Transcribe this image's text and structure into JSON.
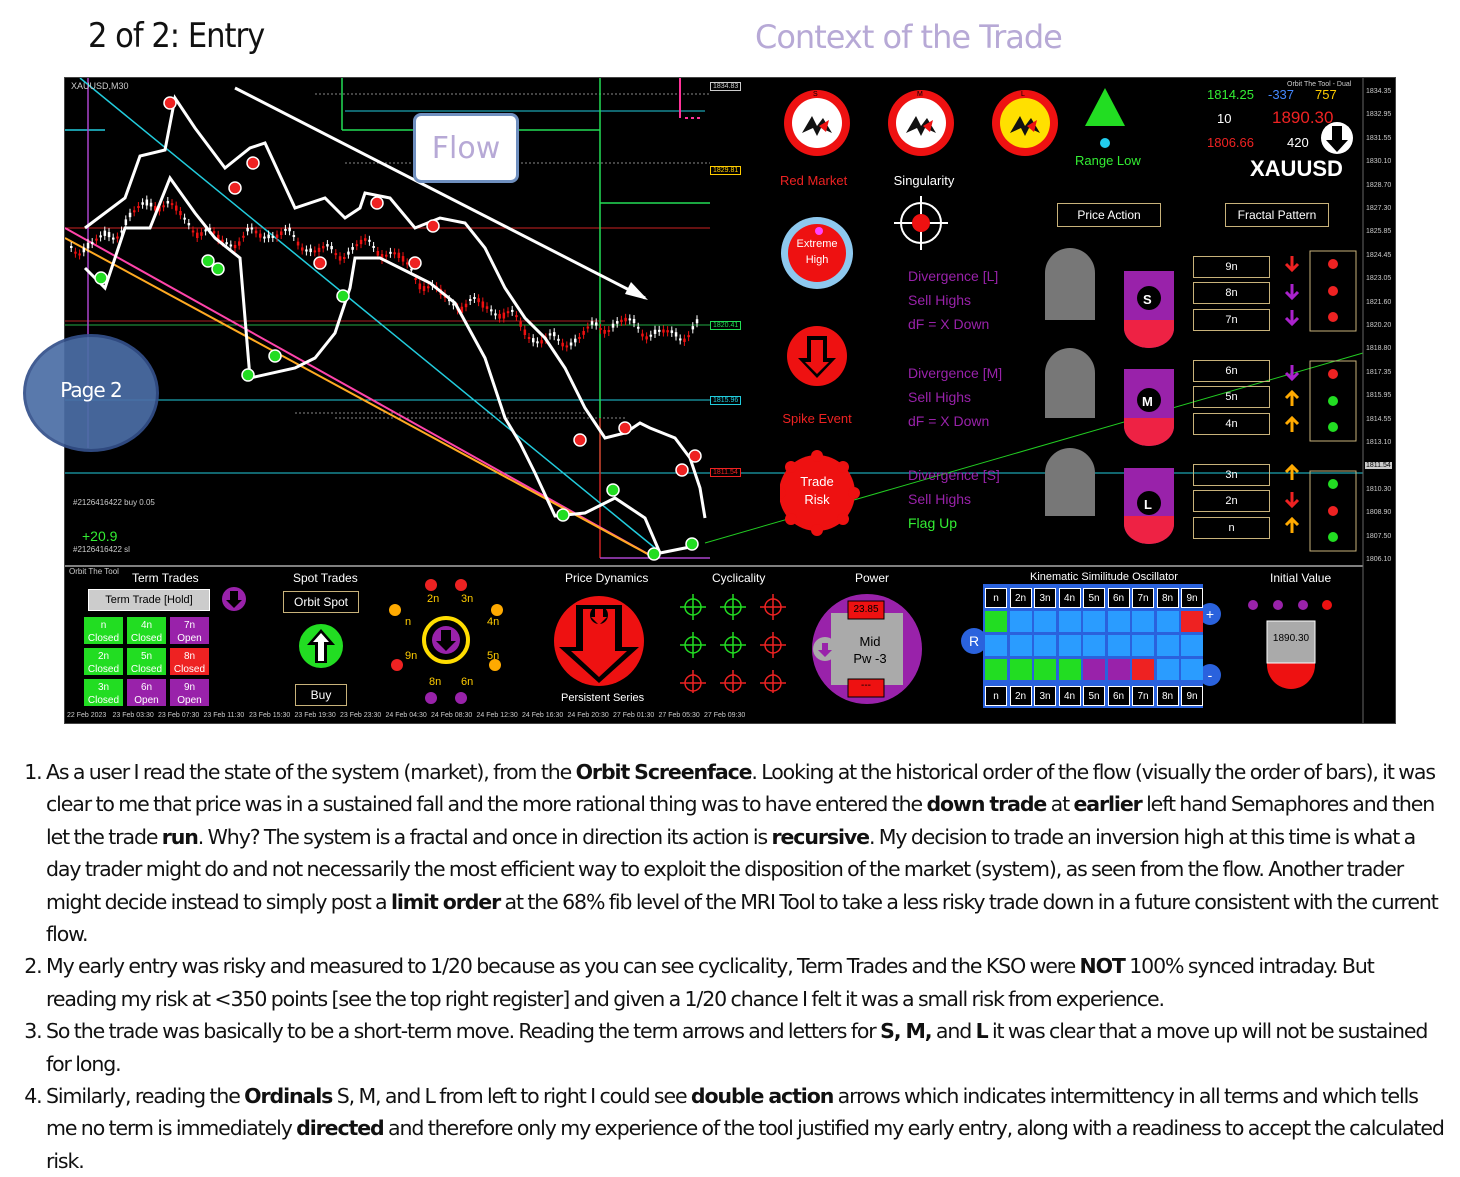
{
  "header": {
    "title_left": "2 of 2: Entry",
    "title_right": "Context of the Trade"
  },
  "chart": {
    "symbol": "XAUUSD,M30",
    "flow_label": "Flow",
    "page_label": "Page 2",
    "order_buy": "#2126416422 buy 0.05",
    "order_sl": "#2126416422 sl",
    "profit": "+20.9",
    "price_tags": [
      "1834.83",
      "1829.81",
      "1820.41",
      "1815.96",
      "1811.54"
    ],
    "right_axis": [
      "1834.35",
      "1832.95",
      "1831.55",
      "1830.10",
      "1828.70",
      "1827.30",
      "1825.85",
      "1824.45",
      "1823.05",
      "1821.60",
      "1820.20",
      "1818.80",
      "1817.35",
      "1815.95",
      "1814.55",
      "1813.10",
      "1811.54",
      "1810.30",
      "1808.90",
      "1807.50",
      "1806.10"
    ],
    "time_axis": [
      "22 Feb 2023",
      "23 Feb 03:30",
      "23 Feb 07:30",
      "23 Feb 11:30",
      "23 Feb 15:30",
      "23 Feb 19:30",
      "23 Feb 23:30",
      "24 Feb 04:30",
      "24 Feb 08:30",
      "24 Feb 12:30",
      "24 Feb 16:30",
      "24 Feb 20:30",
      "27 Feb 01:30",
      "27 Feb 05:30",
      "27 Feb 09:30"
    ]
  },
  "context": {
    "sem_s": "S",
    "sem_m": "M",
    "sem_l": "L",
    "red_market": "Red Market",
    "singularity": "Singularity",
    "range_low": "Range Low",
    "extreme_high": "Extreme High",
    "spike_event": "Spike Event",
    "trade_risk": "Trade Risk",
    "div_l": [
      "Divergence [L]",
      "Sell Highs",
      "dF = X Down"
    ],
    "div_m": [
      "Divergence [M]",
      "Sell Highs",
      "dF = X Down"
    ],
    "div_s": [
      "Divergence [S]",
      "Sell Highs",
      "Flag Up"
    ],
    "price_action": "Price Action",
    "fractal_pattern": "Fractal Pattern",
    "term_s": "S",
    "term_m": "M",
    "term_l": "L",
    "ordinals": [
      "9n",
      "8n",
      "7n",
      "6n",
      "5n",
      "4n",
      "3n",
      "2n",
      "n"
    ],
    "register": {
      "v1": "1814.25",
      "v2": "-337",
      "v3": "757",
      "v4": "10",
      "v5": "1890.30",
      "v6": "1806.66",
      "v7": "420",
      "symbol": "XAUUSD",
      "tool": "Orbit The Tool - Dual"
    }
  },
  "bottom": {
    "tool_name": "Orbit The Tool",
    "term_trades": "Term Trades",
    "term_trade_hold": "Term Trade [Hold]",
    "term_cells": [
      {
        "t": "n",
        "s": "Closed",
        "c": "#22dd22"
      },
      {
        "t": "4n",
        "s": "Closed",
        "c": "#22dd22"
      },
      {
        "t": "7n",
        "s": "Open",
        "c": "#9922aa"
      },
      {
        "t": "2n",
        "s": "Closed",
        "c": "#22dd22"
      },
      {
        "t": "5n",
        "s": "Closed",
        "c": "#22dd22"
      },
      {
        "t": "8n",
        "s": "Closed",
        "c": "#ee2222"
      },
      {
        "t": "3n",
        "s": "Closed",
        "c": "#22dd22"
      },
      {
        "t": "6n",
        "s": "Open",
        "c": "#9922aa"
      },
      {
        "t": "9n",
        "s": "Open",
        "c": "#9922aa"
      }
    ],
    "spot_trades": "Spot Trades",
    "orbit_spot": "Orbit Spot",
    "buy": "Buy",
    "wheel_labels": [
      "2n",
      "3n",
      "4n",
      "5n",
      "6n",
      "8n",
      "9n",
      "n"
    ],
    "price_dynamics": "Price Dynamics",
    "persistent_series": "Persistent Series",
    "cyclicality": "Cyclicality",
    "power": "Power",
    "power_value": "23.85",
    "power_mid": "Mid",
    "power_pw": "Pw -3",
    "power_dash": "---",
    "kso_title": "Kinematic Similitude Oscillator",
    "kso_labels": [
      "n",
      "2n",
      "3n",
      "4n",
      "5n",
      "6n",
      "7n",
      "8n",
      "9n"
    ],
    "kso_r": "R",
    "kso_plus": "+",
    "kso_minus": "-",
    "initial_value": "Initial Value",
    "initial_price": "1890.30"
  },
  "notes": {
    "p1": [
      "As a user I read the state of the system (market), from  the ",
      "Orbit Screenface",
      ". Looking at the historical order of the flow (visually the order of bars), it was clear to me that price was in a sustained fall and the more rational thing was to have entered the ",
      "down  trade",
      " at ",
      "earlier",
      " left hand Semaphores and then let the trade ",
      "run",
      ". Why? The system is a fractal and once in direction its action is ",
      "recursive",
      ". My decision to trade an inversion high at this time is what a day trader might do and not necessarily the most efficient  way to exploit the disposition of the market (system), as seen from the flow. Another trader might decide instead to simply post a ",
      "limit order",
      " at the 68% fib level of the MRI Tool to take a less risky trade down in a future consistent with the current flow."
    ],
    "p2": [
      "My early entry was risky and measured to 1/20 because as you can see cyclicality, Term Trades and the KSO were ",
      "NOT",
      " 100% synced intraday. But reading my risk at <350 points [see the top right register] and given a 1/20 chance I felt it was a small risk from experience."
    ],
    "p3": [
      "So the trade was basically to be a short-term move. Reading the term arrows and letters for ",
      "S, M,",
      " and ",
      "L",
      " it was clear that a move up will not be sustained for long."
    ],
    "p4": [
      "Similarly, reading the ",
      "Ordinals",
      " S, M, and L from left to right I could see ",
      "double action",
      " arrows which indicates intermittency in all terms and which tells me no term is immediately ",
      "directed",
      " and therefore  only my experience of the tool justified my early entry, along with a readiness to accept the calculated risk."
    ]
  }
}
